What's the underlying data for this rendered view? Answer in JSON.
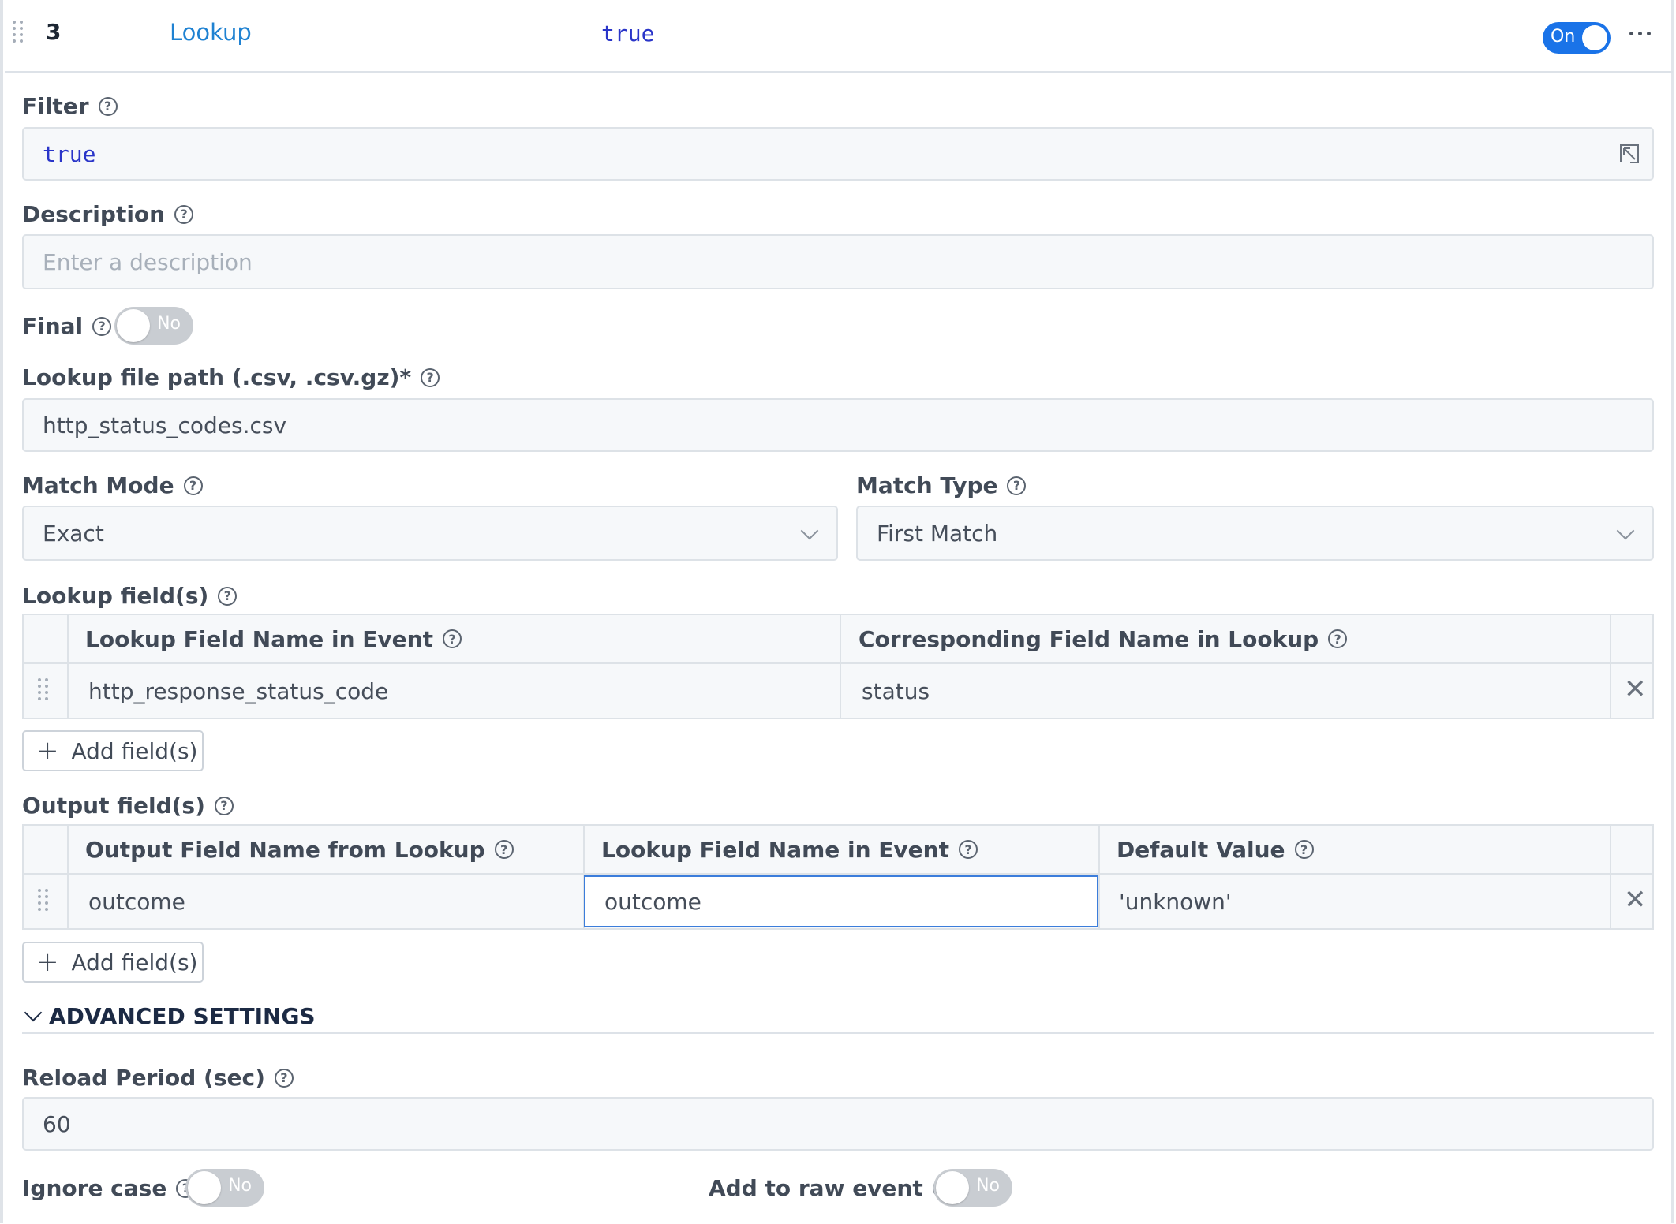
{
  "header": {
    "index": "3",
    "function_name": "Lookup",
    "filter_expr": "true",
    "enabled_label": "On"
  },
  "filter": {
    "label": "Filter",
    "value": "true"
  },
  "description": {
    "label": "Description",
    "placeholder": "Enter a description"
  },
  "final": {
    "label": "Final",
    "toggle_label": "No"
  },
  "lookup_file": {
    "label": "Lookup file path (.csv, .csv.gz)*",
    "value": "http_status_codes.csv"
  },
  "match_mode": {
    "label": "Match Mode",
    "value": "Exact"
  },
  "match_type": {
    "label": "Match Type",
    "value": "First Match"
  },
  "lookup_fields": {
    "label": "Lookup field(s)",
    "columns": [
      "Lookup Field Name in Event",
      "Corresponding Field Name in Lookup"
    ],
    "rows": [
      [
        "http_response_status_code",
        "status"
      ]
    ],
    "add_label": "Add field(s)"
  },
  "output_fields": {
    "label": "Output field(s)",
    "columns": [
      "Output Field Name from Lookup",
      "Lookup Field Name in Event",
      "Default Value"
    ],
    "rows": [
      [
        "outcome",
        "outcome",
        "'unknown'"
      ]
    ],
    "add_label": "Add field(s)"
  },
  "advanced": {
    "label": "ADVANCED SETTINGS"
  },
  "reload_period": {
    "label": "Reload Period (sec)",
    "value": "60"
  },
  "ignore_case": {
    "label": "Ignore case",
    "toggle_label": "No"
  },
  "add_to_raw": {
    "label": "Add to raw event",
    "toggle_label": "No"
  },
  "colors": {
    "accent": "#1a73e8",
    "link": "#1f82d2",
    "code": "#2a35c9",
    "focus_border": "#3b7ddb"
  }
}
